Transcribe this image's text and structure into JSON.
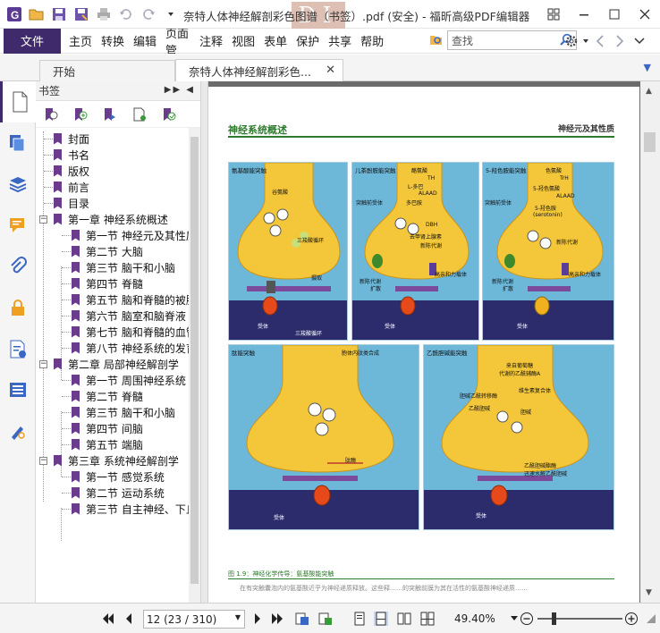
{
  "app": {
    "title": "奈特人体神经解剖彩色图谱（书签）.pdf (安全) - 福昕高级PDF编辑器"
  },
  "menu": {
    "file": "文件",
    "items": [
      "主页",
      "转换",
      "编辑",
      "页面管",
      "注释",
      "视图",
      "表单",
      "保护",
      "共享",
      "帮助"
    ]
  },
  "search": {
    "placeholder": "查找"
  },
  "tabs": [
    {
      "label": "开始"
    },
    {
      "label": "奈特人体神经解剖彩色..."
    }
  ],
  "bookmarks": {
    "panel_title": "书签",
    "items": [
      {
        "label": "封面",
        "level": 1
      },
      {
        "label": "书名",
        "level": 1
      },
      {
        "label": "版权",
        "level": 1
      },
      {
        "label": "前言",
        "level": 1
      },
      {
        "label": "目录",
        "level": 1
      },
      {
        "label": "第一章 神经系统概述",
        "level": 1,
        "expanded": true
      },
      {
        "label": "第一节 神经元及其性质",
        "level": 2
      },
      {
        "label": "第二节 大脑",
        "level": 2
      },
      {
        "label": "第三节 脑干和小脑",
        "level": 2
      },
      {
        "label": "第四节 脊髓",
        "level": 2
      },
      {
        "label": "第五节 脑和脊髓的被膜",
        "level": 2
      },
      {
        "label": "第六节 脑室和脑脊液",
        "level": 2
      },
      {
        "label": "第七节 脑和脊髓的血管",
        "level": 2
      },
      {
        "label": "第八节 神经系统的发育",
        "level": 2
      },
      {
        "label": "第二章 局部神经解剖学",
        "level": 1,
        "expanded": true
      },
      {
        "label": "第一节 周围神经系统",
        "level": 2
      },
      {
        "label": "第二节 脊髓",
        "level": 2
      },
      {
        "label": "第三节 脑干和小脑",
        "level": 2
      },
      {
        "label": "第四节 间脑",
        "level": 2
      },
      {
        "label": "第五节 端脑",
        "level": 2
      },
      {
        "label": "第三章 系统神经解剖学",
        "level": 1,
        "expanded": true
      },
      {
        "label": "第一节 感觉系统",
        "level": 2
      },
      {
        "label": "第二节 运动系统",
        "level": 2
      },
      {
        "label": "第三节 自主神经、下丘",
        "level": 2
      }
    ]
  },
  "page": {
    "heading": "神经系统概述",
    "section": "神经元及其性质",
    "figures": [
      {
        "title": "氨基酸能突触",
        "labels": [
          "谷氨酸",
          "三羧酸循环",
          "摄取",
          "受体",
          "三羧酸循环"
        ]
      },
      {
        "title": "儿茶酚胺能突触",
        "labels": [
          "酪氨酸",
          "TH",
          "L-多巴",
          "ALAAD",
          "多巴胺",
          "DBH",
          "去甲肾上腺素",
          "新陈代谢",
          "突触前受体",
          "高亲和力载体",
          "新陈代谢",
          "扩散",
          "受体"
        ]
      },
      {
        "title": "5-羟色胺能突触",
        "labels": [
          "色氨酸",
          "TrH",
          "5-羟色氨酸",
          "ALAAD",
          "5-羟色胺",
          "(serotonin)",
          "突触前受体",
          "新陈代谢",
          "高亲和力载体",
          "新陈代谢",
          "扩散",
          "受体"
        ]
      },
      {
        "title": "肽能突触",
        "labels": [
          "胞体内肽类合成",
          "肽酶",
          "受体"
        ]
      },
      {
        "title": "乙酰胆碱能突触",
        "labels": [
          "来自葡萄糖",
          "代谢的乙酰辅酶A",
          "维生素复合体",
          "胆碱乙酰转移酶",
          "乙酰胆碱",
          "胆碱",
          "乙酰胆碱酯酶",
          "迅速水解乙酰胆碱",
          "受体"
        ]
      }
    ],
    "caption": "图 1.9：神经化学传导：氨基酸能突触",
    "body_text": "在有突触囊泡内的氨基酸近乎为神经递质释放。这些释……的突触前膜为其在活性的氨基酸神经递质……"
  },
  "status": {
    "page_indicator": "12 (23 / 310)",
    "zoom": "49.40%"
  },
  "colors": {
    "brand": "#3f2a6c",
    "bookmark_flag": "#6b3c8e",
    "heading_green": "#2c7a2c",
    "figure_bg": "#6db7d9"
  }
}
